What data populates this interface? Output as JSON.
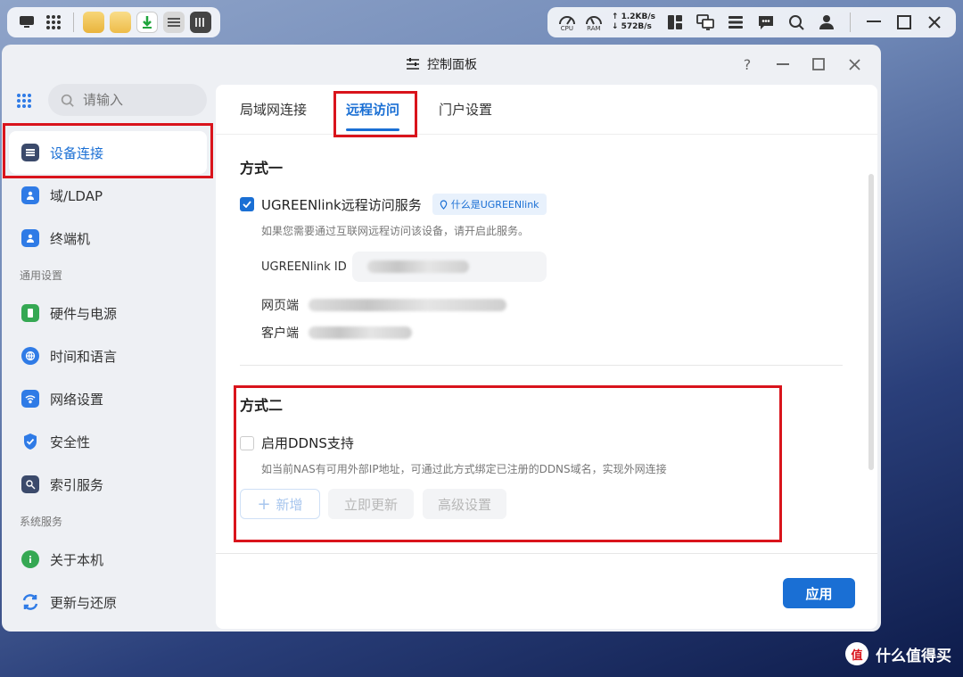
{
  "sysbar": {
    "cpu_label": "CPU",
    "ram_label": "RAM",
    "upload": "1.2KB/s",
    "download": "572B/s"
  },
  "window": {
    "title": "控制面板",
    "help": "?"
  },
  "sidebar": {
    "search_placeholder": "请输入",
    "items": [
      {
        "label": "设备连接",
        "icon": "device-icon",
        "color": "#3b4a6b"
      },
      {
        "label": "域/LDAP",
        "icon": "id-card-icon",
        "color": "#2f7be6"
      },
      {
        "label": "终端机",
        "icon": "terminal-icon",
        "color": "#2f7be6"
      }
    ],
    "section_general": "通用设置",
    "general_items": [
      {
        "label": "硬件与电源",
        "icon": "power-icon",
        "color": "#35a853"
      },
      {
        "label": "时间和语言",
        "icon": "globe-icon",
        "color": "#2f7be6"
      },
      {
        "label": "网络设置",
        "icon": "network-icon",
        "color": "#2f7be6"
      },
      {
        "label": "安全性",
        "icon": "shield-icon",
        "color": "#2f7be6"
      },
      {
        "label": "索引服务",
        "icon": "index-icon",
        "color": "#3b4a6b"
      }
    ],
    "section_system": "系统服务",
    "system_items": [
      {
        "label": "关于本机",
        "icon": "info-icon",
        "color": "#35a853"
      },
      {
        "label": "更新与还原",
        "icon": "refresh-icon",
        "color": "#2f7be6"
      }
    ]
  },
  "tabs": [
    "局域网连接",
    "远程访问",
    "门户设置"
  ],
  "method1": {
    "title": "方式一",
    "checkbox_label": "UGREENlink远程访问服务",
    "badge": "什么是UGREENlink",
    "hint": "如果您需要通过互联网远程访问该设备，请开启此服务。",
    "id_label": "UGREENlink ID",
    "web_label": "网页端",
    "client_label": "客户端"
  },
  "method2": {
    "title": "方式二",
    "checkbox_label": "启用DDNS支持",
    "hint": "如当前NAS有可用外部IP地址，可通过此方式绑定已注册的DDNS域名，实现外网连接",
    "btn_add": "新增",
    "btn_update": "立即更新",
    "btn_advanced": "高级设置"
  },
  "apply_label": "应用",
  "watermark": {
    "logo": "值",
    "text": "什么值得买"
  }
}
